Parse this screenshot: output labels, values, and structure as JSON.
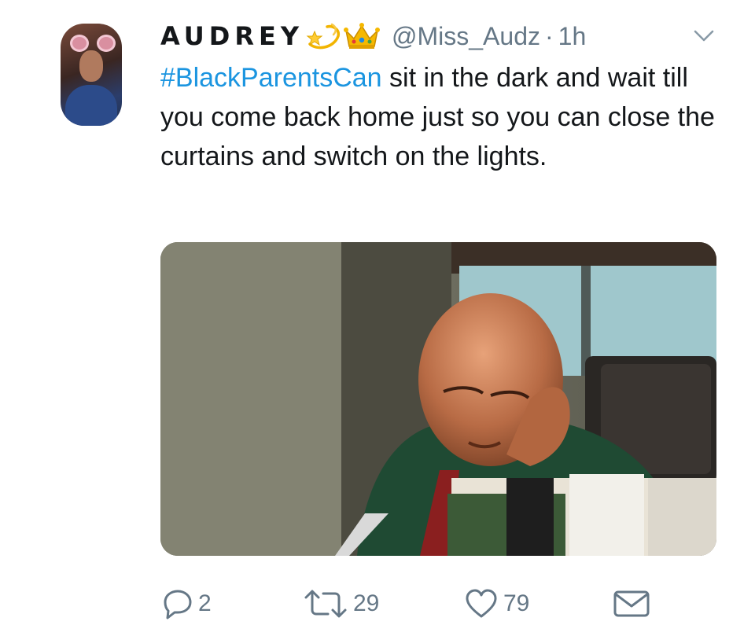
{
  "tweet": {
    "display_name": "AUDREY",
    "handle": "@Miss_Audz",
    "separator": "·",
    "time": "1h",
    "hashtag": "#BlackParentsCan",
    "body": " sit in the dark and wait till you come back home just so you can close the curtains and switch on the lights.",
    "name_emojis": [
      "dizzy-star-emoji",
      "crown-emoji"
    ]
  },
  "actions": {
    "reply_count": "2",
    "retweet_count": "29",
    "like_count": "79"
  },
  "icons": [
    "reply-icon",
    "retweet-icon",
    "like-icon",
    "dm-icon",
    "chevron-down-icon"
  ],
  "colors": {
    "link": "#1b95e0",
    "secondary_text": "#657786",
    "text": "#14171a"
  }
}
